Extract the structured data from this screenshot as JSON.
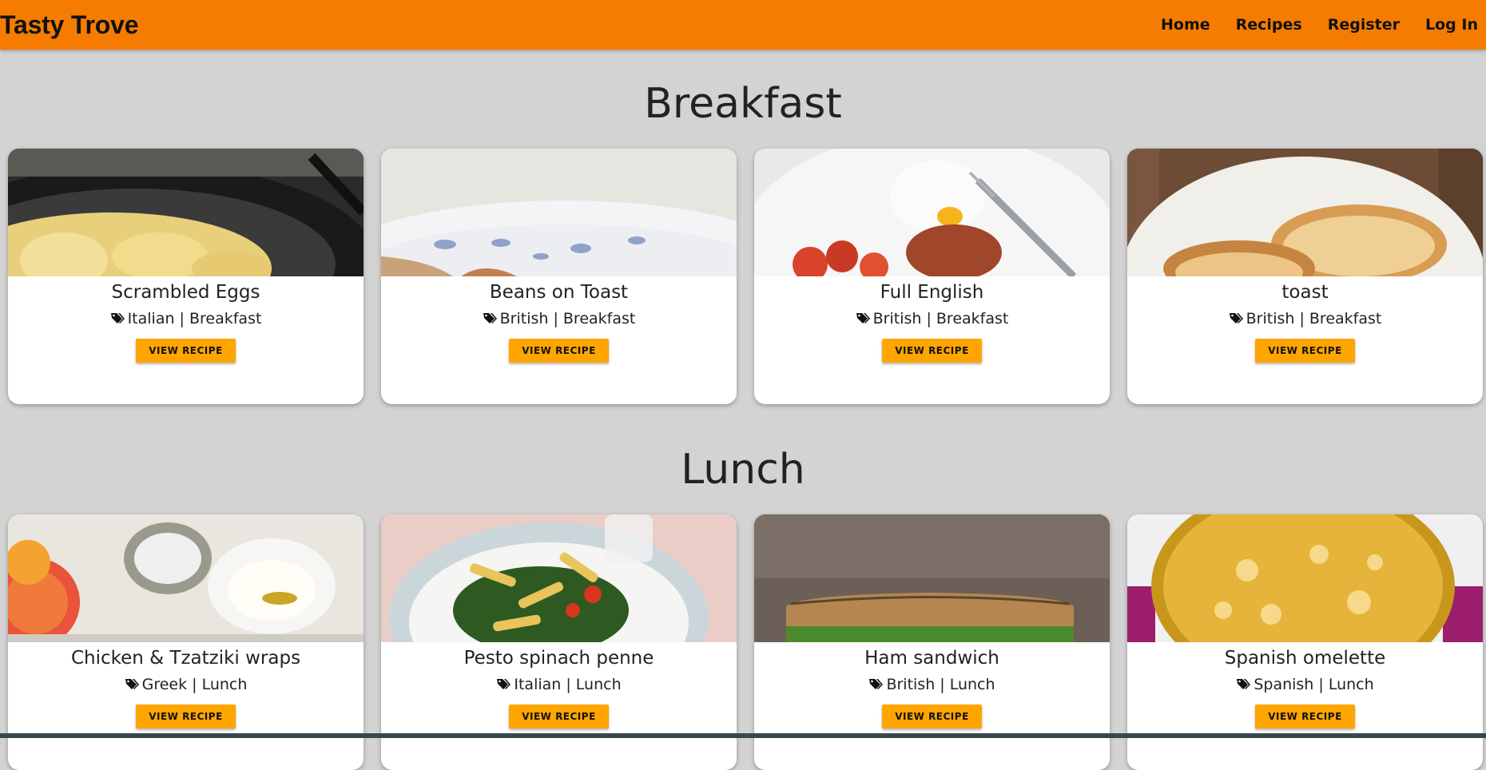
{
  "navbar": {
    "brand": "Tasty Trove",
    "links": [
      "Home",
      "Recipes",
      "Register",
      "Log In"
    ],
    "color": "#f57c00"
  },
  "sections": [
    {
      "title": "Breakfast",
      "cards": [
        {
          "title": "Scrambled Eggs",
          "tags": "Italian | Breakfast",
          "button": "VIEW RECIPE",
          "image": "scrambled-eggs-photo"
        },
        {
          "title": "Beans on Toast",
          "tags": "British | Breakfast",
          "button": "VIEW RECIPE",
          "image": "beans-on-toast-photo"
        },
        {
          "title": "Full English",
          "tags": "British | Breakfast",
          "button": "VIEW RECIPE",
          "image": "full-english-photo"
        },
        {
          "title": "toast",
          "tags": "British | Breakfast",
          "button": "VIEW RECIPE",
          "image": "toast-photo"
        }
      ]
    },
    {
      "title": "Lunch",
      "cards": [
        {
          "title": "Chicken & Tzatziki wraps",
          "tags": "Greek | Lunch",
          "button": "VIEW RECIPE",
          "image": "chicken-tzatziki-photo"
        },
        {
          "title": "Pesto spinach penne",
          "tags": "Italian | Lunch",
          "button": "VIEW RECIPE",
          "image": "pesto-penne-photo"
        },
        {
          "title": "Ham sandwich",
          "tags": "British | Lunch",
          "button": "VIEW RECIPE",
          "image": "ham-sandwich-photo"
        },
        {
          "title": "Spanish omelette",
          "tags": "Spanish | Lunch",
          "button": "VIEW RECIPE",
          "image": "spanish-omelette-photo"
        }
      ]
    }
  ],
  "colors": {
    "accent": "#f57c00",
    "button": "#ffa500",
    "background": "#d3d3d3"
  }
}
